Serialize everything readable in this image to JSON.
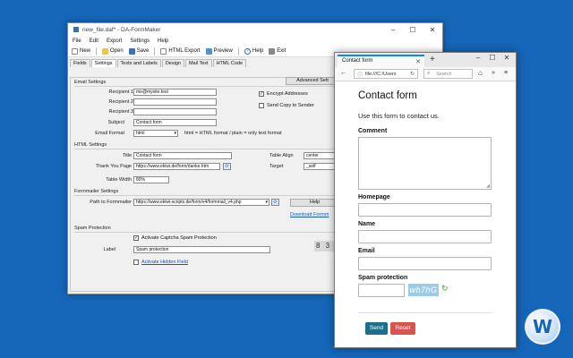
{
  "formmaker": {
    "title": "new_file.daf* - DA-FormMaker",
    "menu": [
      "File",
      "Edit",
      "Export",
      "Settings",
      "Help"
    ],
    "toolbar": {
      "new": "New",
      "open": "Open",
      "save": "Save",
      "html_export": "HTML Export",
      "preview": "Preview",
      "help": "Help",
      "exit": "Exit"
    },
    "tabs": [
      "Fields",
      "Settings",
      "Texts and Labels",
      "Design",
      "Mail Text",
      "HTML Code"
    ],
    "email_settings": {
      "section": "Email Settings",
      "recipient1_label": "Recipient 1",
      "recipient1_value": "me@mysite.test",
      "recipient2_label": "Recipient 2",
      "recipient2_value": "",
      "recipient3_label": "Recipient 3",
      "recipient3_value": "",
      "subject_label": "Subject",
      "subject_value": "Contact form",
      "email_format_label": "Email Format",
      "email_format_value": "html",
      "email_format_hint": "html = HTML format / plain = only text format",
      "advanced_button": "Advanced Sett",
      "encrypt_label": "Encrypt Addresses",
      "encrypt_checked": "✓",
      "copy_sender_label": "Send Copy to Sender"
    },
    "html_settings": {
      "section": "HTML Settings",
      "title_label": "Title",
      "title_value": "Contact form",
      "thankyou_label": "Thank You Page",
      "thankyou_value": "https://www.ekiwi.de/form/danke.htm",
      "table_align_label": "Table Align",
      "table_align_value": "center",
      "target_label": "Target",
      "target_value": "_self",
      "table_width_label": "Table Width",
      "table_width_value": "80%"
    },
    "formmailer_settings": {
      "section": "Formmailer Settings",
      "path_label": "Path to Formmailer",
      "path_value": "https://www.ekiwi-scripts.de/form/v4/formmail_v4.php",
      "help_button": "Help",
      "download_link": "Download Formm"
    },
    "spam_protection": {
      "section": "Spam Protection",
      "activate_captcha_label": "Activate Captcha Spam Protection",
      "activate_captcha_checked": "✓",
      "label_label": "Label",
      "label_value": "Spam protection",
      "hidden_field_label": "Activate Hidden Field"
    }
  },
  "browser": {
    "tab_title": "Contact form",
    "url": "file:///C:/Users",
    "search_placeholder": "Search",
    "page": {
      "heading": "Contact form",
      "intro": "Use this form to contact us.",
      "comment_label": "Comment",
      "homepage_label": "Homepage",
      "name_label": "Name",
      "email_label": "Email",
      "spam_label": "Spam protection",
      "captcha_text": "wh7hG",
      "send_button": "Send",
      "reset_button": "Reset"
    }
  },
  "colors": {
    "desktop": "#1565b8",
    "send_button": "#1f6f8b",
    "reset_button": "#d9534f",
    "firefox_tab_accent": "#0a84ff",
    "link": "#1a55c2"
  },
  "watermark": {
    "letter": "W"
  }
}
